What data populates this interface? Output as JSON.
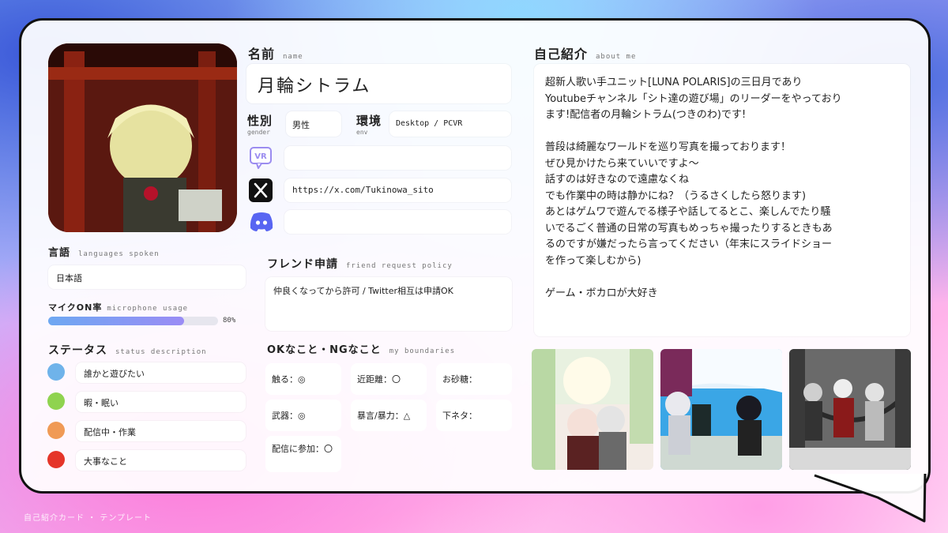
{
  "name": {
    "heading": "名前",
    "sub": "name",
    "value": "月輪シトラム"
  },
  "gender": {
    "heading": "性別",
    "sub": "gender",
    "value": "男性"
  },
  "env": {
    "heading": "環境",
    "sub": "env",
    "value": "Desktop / PCVR"
  },
  "icons": {
    "vrchat": "vrchat-icon",
    "x": "x-icon",
    "discord": "discord-icon"
  },
  "vrchat_value": "",
  "x_value": "https://x.com/Tukinowa_sito",
  "discord_value": "",
  "languages": {
    "heading": "言語",
    "sub": "languages spoken",
    "value": "日本語"
  },
  "mic": {
    "heading": "マイクON率",
    "sub": "microphone usage",
    "value_label": "80%",
    "value": 0.8
  },
  "status": {
    "heading": "ステータス",
    "sub": "status description",
    "items": [
      {
        "label": "誰かと遊びたい",
        "color": "#6fb3ea"
      },
      {
        "label": "暇・眠い",
        "color": "#8fd34f"
      },
      {
        "label": "配信中・作業",
        "color": "#f09a55"
      },
      {
        "label": "大事なこと",
        "color": "#e53529"
      }
    ]
  },
  "friend": {
    "heading": "フレンド申請",
    "sub": "friend request policy",
    "value": "仲良くなってから許可 / Twitter相互は申請OK"
  },
  "boundaries": {
    "heading": "OKなこと・NGなこと",
    "sub": "my boundaries",
    "items": [
      "触る：◎",
      "近距離：〇",
      "お砂糖：",
      "武器：◎",
      "暴言/暴力：△",
      "下ネタ：",
      "配信に参加：〇"
    ]
  },
  "about": {
    "heading": "自己紹介",
    "sub": "about me",
    "text": "超新人歌い手ユニット[LUNA POLARIS]の三日月であり\nYoutubeチャンネル「シト達の遊び場」のリーダーをやっており\nます!配信者の月輪シトラム(つきのわ)です!\n\n普段は綺麗なワールドを巡り写真を撮っております！\nぜひ見かけたら来ていいですよ～\n話すのは好きなので遠慮なくね\nでも作業中の時は静かにね？（うるさくしたら怒ります)\nあとはゲムワで遊んでる様子や話してるとこ、楽しんでたり騒\nいでるごく普通の日常の写真もめっちゃ撮ったりするときもあ\nるのですが嫌だったら言ってください（年末にスライドショー\nを作って楽しむから)\n\nゲーム・ボカロが大好き"
  },
  "colors": {
    "accent": "#111111",
    "bar_start": "#6ea8f2",
    "bar_end": "#9a8cf5"
  },
  "watermark": "自己紹介カード ・ テンプレート"
}
